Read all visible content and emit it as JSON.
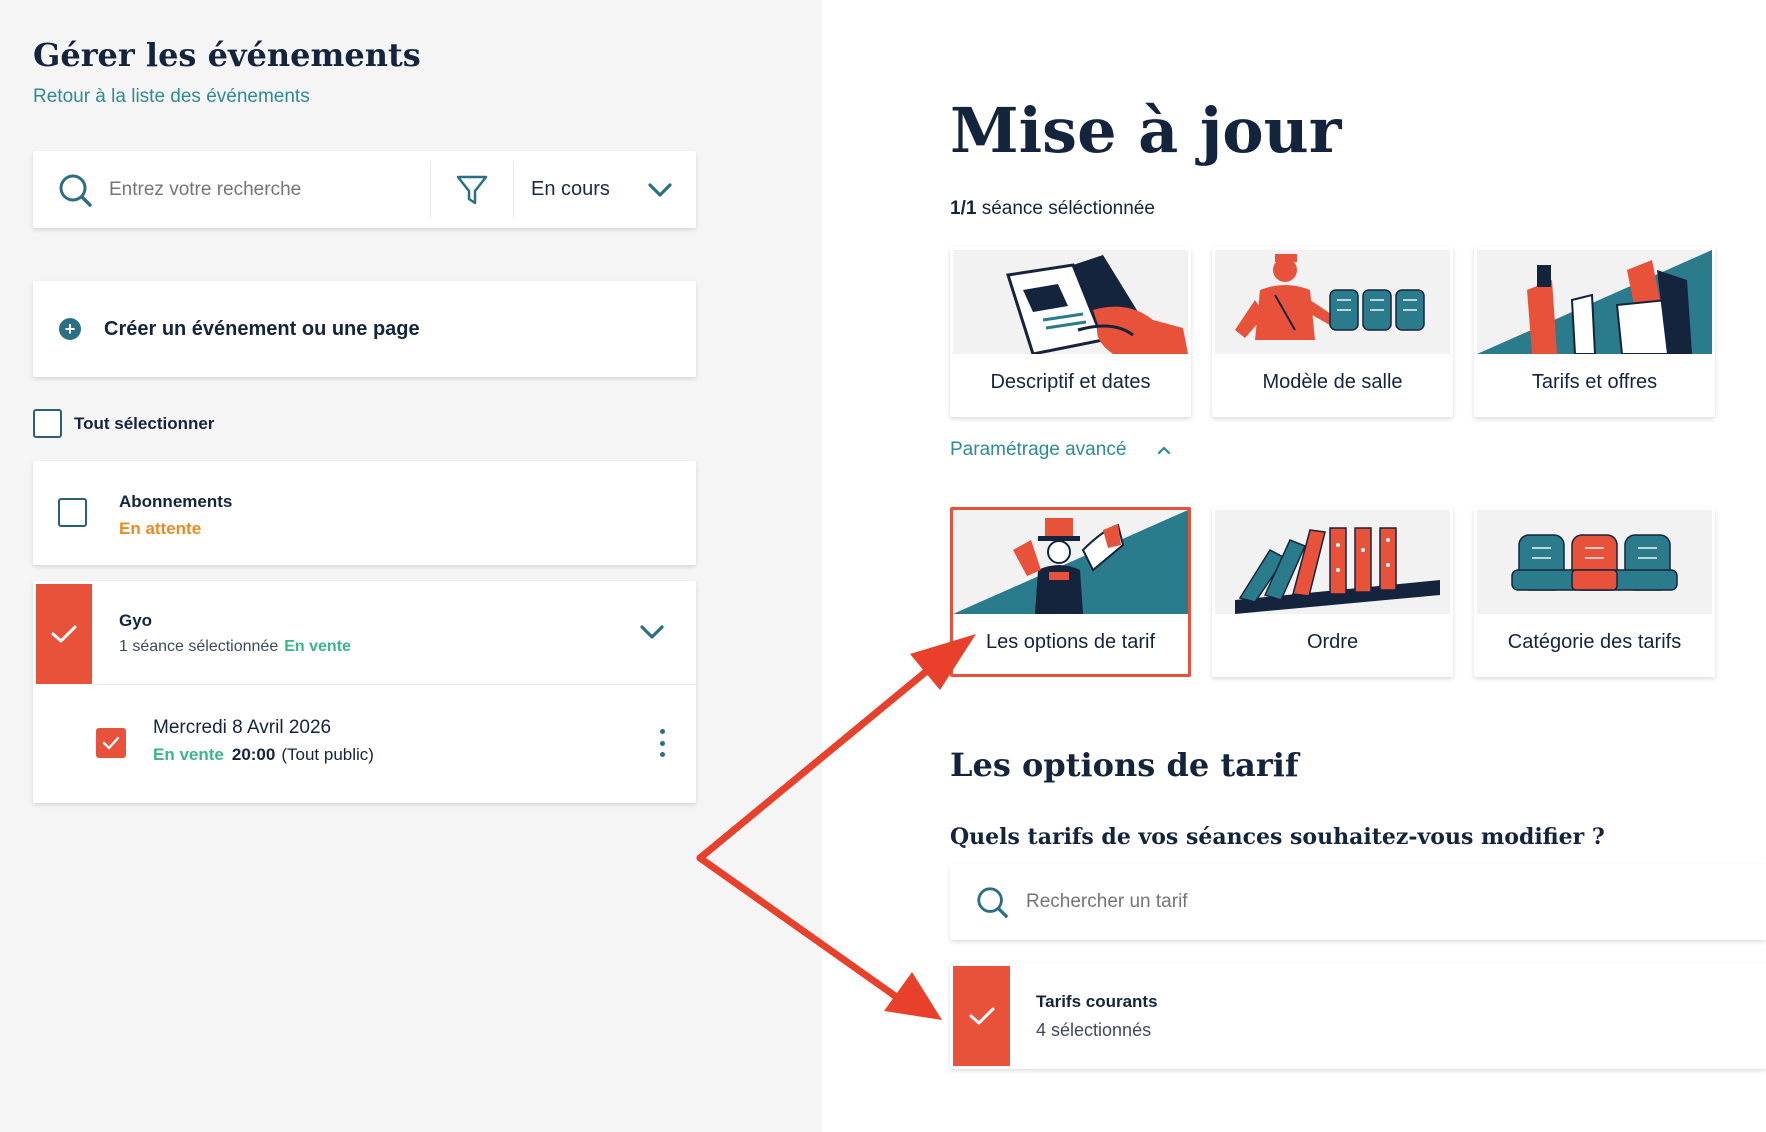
{
  "sidebar": {
    "title": "Gérer les événements",
    "back_link": "Retour à la liste des événements",
    "search": {
      "placeholder": "Entrez votre recherche",
      "status_filter": "En cours"
    },
    "create_label": "Créer un événement ou une page",
    "select_all_label": "Tout sélectionner",
    "events": [
      {
        "name": "Abonnements",
        "status": "En attente",
        "checked": false
      },
      {
        "name": "Gyo",
        "sessions_text": "1 séance sélectionnée",
        "status": "En vente",
        "checked": true,
        "session": {
          "date": "Mercredi  8  Avril 2026",
          "status": "En vente",
          "time": "20:00",
          "audience": "(Tout public)",
          "checked": true
        }
      }
    ]
  },
  "main": {
    "title": "Mise à jour",
    "selection_count": "1/1",
    "selection_text": "séance séléctionnée",
    "tiles": [
      {
        "label": "Descriptif et dates",
        "icon": "magazine-illustration"
      },
      {
        "label": "Modèle de salle",
        "icon": "usher-seats-illustration"
      },
      {
        "label": "Tarifs et offres",
        "icon": "tickets-hands-illustration"
      }
    ],
    "advanced_label": "Paramétrage avancé",
    "advanced_tiles": [
      {
        "label": "Les options de tarif",
        "icon": "magician-illustration",
        "selected": true
      },
      {
        "label": "Ordre",
        "icon": "dominoes-illustration",
        "selected": false
      },
      {
        "label": "Catégorie des tarifs",
        "icon": "seats-illustration",
        "selected": false
      }
    ],
    "section_title": "Les options de tarif",
    "question": "Quels tarifs de vos séances souhaitez-vous modifier ?",
    "tarif_search_placeholder": "Rechercher un tarif",
    "tarif_group": {
      "name": "Tarifs courants",
      "count": "4 sélectionnés",
      "checked": true
    }
  },
  "colors": {
    "accent_red": "#e8513a",
    "teal": "#2e8a93",
    "navy": "#15243d",
    "green": "#3bb58a",
    "orange": "#e88b23",
    "illus_teal": "#2a7b8c"
  }
}
